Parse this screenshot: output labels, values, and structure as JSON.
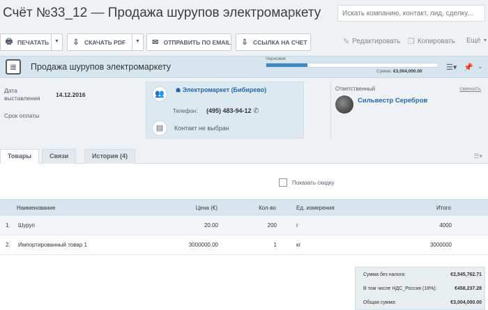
{
  "title": "Счёт №33_12 — Продажа шурупов электромаркету",
  "search": {
    "placeholder": "Искать компанию, контакт, лид, сделку..."
  },
  "toolbar": {
    "print": "ПЕЧАТАТЬ",
    "pdf": "СКАЧАТЬ PDF",
    "email": "ОТПРАВИТЬ ПО EMAIL",
    "link": "ССЫЛКА НА СЧЕТ",
    "edit": "Редактировать",
    "copy": "Копировать",
    "more": "Ещё"
  },
  "header": {
    "doc_title": "Продажа шурупов электромаркету",
    "status": "Черновик",
    "progress": 0.24,
    "sum_label": "Сумма:",
    "sum_value": "€3,004,000.00"
  },
  "info": {
    "date_label_1": "Дата",
    "date_label_2": "выставления",
    "date_value": "14.12.2016",
    "due_label": "Срок оплаты",
    "company": "Электромаркет (Бибирево)",
    "phone_label": "Телефон:",
    "phone_value": "(495) 483-94-12",
    "contact": "Контакт не выбран",
    "responsible_label": "Ответственный",
    "change": "сменить",
    "responsible_name": "Сильвестр Серебров"
  },
  "tabs": [
    {
      "label": "Товары"
    },
    {
      "label": "Связи"
    },
    {
      "label": "История (4)"
    }
  ],
  "products": {
    "discount_label": "Показать скидку",
    "columns": {
      "name": "Наименование",
      "price": "Цена (€)",
      "qty": "Кол-во",
      "unit": "Ед. измерения",
      "total": "Итого"
    },
    "rows": [
      {
        "num": "1.",
        "name": "Шуруп",
        "price": "20.00",
        "qty": "200",
        "unit": "г",
        "total": "4000"
      },
      {
        "num": "2.",
        "name": "Импортированный товар 1",
        "price": "3000000.00",
        "qty": "1",
        "unit": "кг",
        "total": "3000000"
      }
    ]
  },
  "totals": {
    "net_label": "Сумма без налога:",
    "net_value": "€2,545,762.71",
    "vat_label": "В том числе НДС_Россия (18%):",
    "vat_value": "€458,237.28",
    "total_label": "Общая сумма:",
    "total_value": "€3,004,000.00"
  },
  "colors": {
    "accent": "#2067b0",
    "progress": "#3d88c5",
    "header_bg": "#d7e6ee"
  },
  "icons": [
    "star-icon",
    "print-icon",
    "download-icon",
    "mail-icon",
    "link-icon",
    "edit-icon",
    "copy-icon",
    "doc-icon",
    "list-icon",
    "pin-icon",
    "chevron-down-icon",
    "company-icon",
    "contact-icon",
    "phone-icon"
  ]
}
